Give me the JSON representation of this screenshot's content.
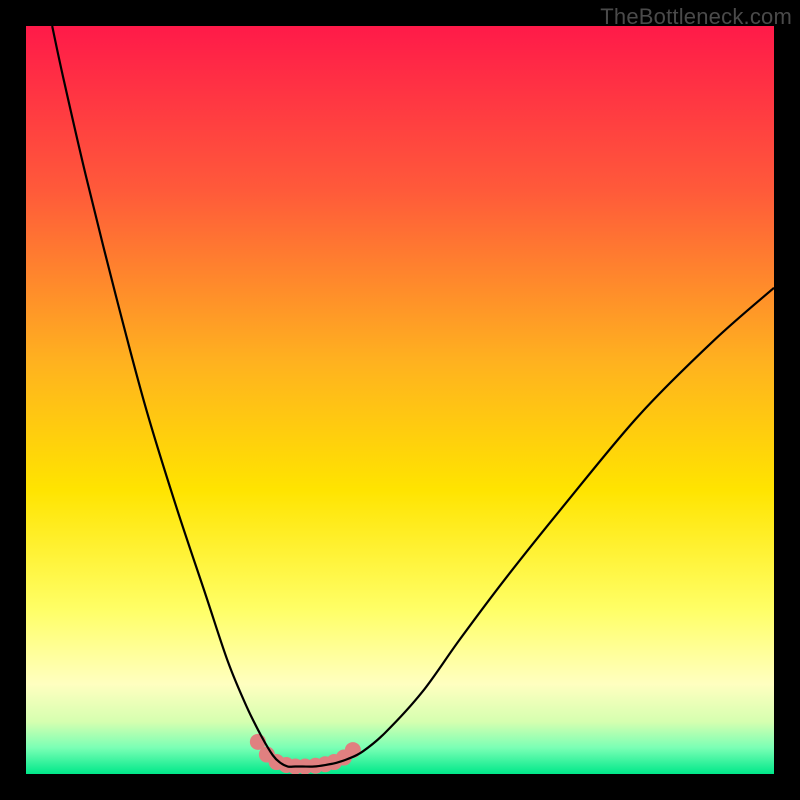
{
  "watermark": "TheBottleneck.com",
  "chart_data": {
    "type": "line",
    "title": "",
    "xlabel": "",
    "ylabel": "",
    "xlim": [
      0,
      100
    ],
    "ylim": [
      0,
      100
    ],
    "background_gradient": {
      "stops": [
        {
          "offset": 0.0,
          "color": "#ff1a49"
        },
        {
          "offset": 0.22,
          "color": "#ff5a3a"
        },
        {
          "offset": 0.45,
          "color": "#ffb21f"
        },
        {
          "offset": 0.62,
          "color": "#ffe400"
        },
        {
          "offset": 0.78,
          "color": "#ffff66"
        },
        {
          "offset": 0.88,
          "color": "#ffffc0"
        },
        {
          "offset": 0.93,
          "color": "#d6ffb0"
        },
        {
          "offset": 0.965,
          "color": "#7affb5"
        },
        {
          "offset": 1.0,
          "color": "#00e88a"
        }
      ]
    },
    "series": [
      {
        "name": "bottleneck-curve",
        "color": "#000000",
        "stroke_width": 2.2,
        "x": [
          3.5,
          5,
          8,
          12,
          16,
          20,
          24,
          27,
          29.5,
          31.5,
          33,
          34,
          35,
          36,
          37,
          38.5,
          40,
          41.5,
          43,
          45,
          48,
          53,
          58,
          64,
          72,
          82,
          92,
          100
        ],
        "y": [
          100,
          93,
          80,
          64,
          49,
          36,
          24,
          15,
          9,
          5,
          2.5,
          1.5,
          1,
          1,
          1,
          1,
          1.2,
          1.5,
          2,
          3,
          5.5,
          11,
          18,
          26,
          36,
          48,
          58,
          65
        ]
      },
      {
        "name": "highlight-dots",
        "color": "#e08080",
        "type": "scatter",
        "marker_radius": 8,
        "x": [
          31.0,
          32.2,
          33.5,
          34.8,
          36.0,
          37.3,
          38.7,
          40.0,
          41.2,
          42.5,
          43.7
        ],
        "y": [
          4.3,
          2.6,
          1.6,
          1.2,
          1.0,
          1.0,
          1.1,
          1.3,
          1.6,
          2.2,
          3.2
        ]
      }
    ]
  }
}
